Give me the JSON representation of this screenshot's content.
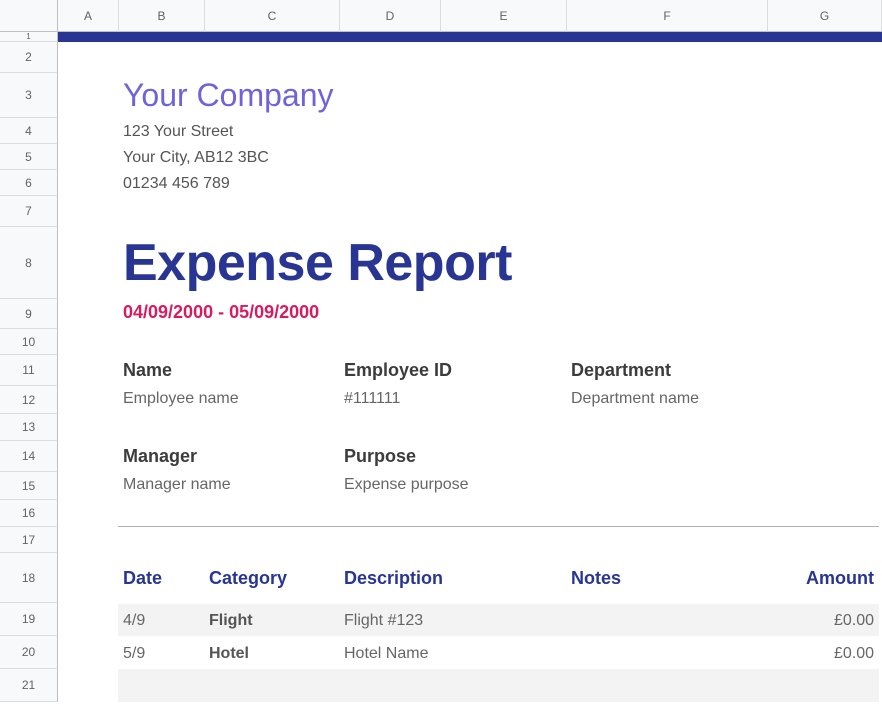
{
  "columns": [
    "A",
    "B",
    "C",
    "D",
    "E",
    "F",
    "G"
  ],
  "rows": [
    "1",
    "2",
    "3",
    "4",
    "5",
    "6",
    "7",
    "8",
    "9",
    "10",
    "11",
    "12",
    "13",
    "14",
    "15",
    "16",
    "17",
    "18",
    "19",
    "20",
    "21"
  ],
  "company": {
    "name": "Your Company",
    "street": "123 Your Street",
    "city": "Your City, AB12 3BC",
    "phone": "01234 456 789"
  },
  "report": {
    "title": "Expense Report",
    "date_range": "04/09/2000 - 05/09/2000"
  },
  "fields": {
    "name_label": "Name",
    "name_value": "Employee name",
    "employee_id_label": "Employee ID",
    "employee_id_value": "#111111",
    "department_label": "Department",
    "department_value": "Department name",
    "manager_label": "Manager",
    "manager_value": "Manager name",
    "purpose_label": "Purpose",
    "purpose_value": "Expense purpose"
  },
  "table": {
    "headers": {
      "date": "Date",
      "category": "Category",
      "description": "Description",
      "notes": "Notes",
      "amount": "Amount"
    },
    "rows": [
      {
        "date": "4/9",
        "category": "Flight",
        "description": "Flight #123",
        "notes": "",
        "amount": "£0.00"
      },
      {
        "date": "5/9",
        "category": "Hotel",
        "description": "Hotel Name",
        "notes": "",
        "amount": "£0.00"
      }
    ]
  },
  "colors": {
    "accent_bar": "#283593",
    "company": "#6f63d9",
    "date_range": "#d81b60"
  }
}
